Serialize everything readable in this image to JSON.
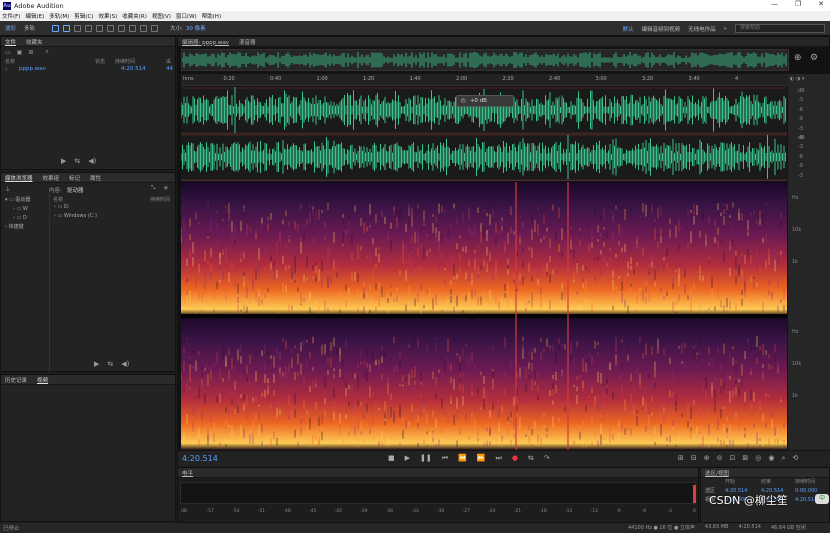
{
  "window": {
    "title": "Adobe Audition",
    "logo": "Au",
    "controls": [
      "—",
      "❐",
      "✕"
    ]
  },
  "menu": [
    "文件(F)",
    "编辑(E)",
    "多轨(M)",
    "剪辑(C)",
    "效果(S)",
    "收藏夹(R)",
    "视图(V)",
    "窗口(W)",
    "帮助(H)"
  ],
  "toolbar": {
    "waveform": "波形",
    "multitrack": "多轨",
    "size_label": "大小:",
    "size_value": "30 像素",
    "workspace_default": "默认",
    "workspace_edit": "编辑音频到视频",
    "workspace_radio": "无线电作品",
    "search_placeholder": "搜索帮助"
  },
  "files_panel": {
    "tabs": [
      "文件",
      "收藏夹"
    ],
    "headers": {
      "name": "名称",
      "status": "状态",
      "duration": "持续时间",
      "rate": "采"
    },
    "file": {
      "name": "pppp.wav",
      "duration": "4:20.514",
      "rate": "44"
    }
  },
  "media_panel": {
    "tabs": [
      "媒体浏览器",
      "效果组",
      "标记",
      "属性"
    ],
    "content_label": "内容:",
    "content_value": "驱动器",
    "headers": {
      "name": "名称",
      "duration": "持续时间"
    },
    "tree_left": [
      "驱动器",
      "W",
      "D",
      "快捷键"
    ],
    "tree_right": [
      "D:",
      "Windows (C:)"
    ]
  },
  "history_panel": {
    "tabs": [
      "历史记录",
      "视频"
    ]
  },
  "editor": {
    "tabs": [
      "编辑器: pppp.wav",
      "混音器"
    ],
    "ruler": [
      "hms",
      "0:20",
      "0:40",
      "1:00",
      "1:20",
      "1:40",
      "2:00",
      "2:20",
      "2:40",
      "3:00",
      "3:20",
      "3:40",
      "4"
    ],
    "db_top": [
      "dB",
      "-3",
      "-6",
      "-9",
      "-3",
      "-9"
    ],
    "db_bottom": [
      "dB",
      "-3",
      "-6",
      "-9",
      "-3"
    ],
    "hz_top": [
      "Hz",
      "10k",
      "1k"
    ],
    "hz_bottom": [
      "Hz",
      "10k",
      "1k"
    ],
    "hud": "+0 dB",
    "timecode": "4:20.514"
  },
  "levels": {
    "title": "电平",
    "scale": [
      "dB",
      "-57",
      "-54",
      "-51",
      "-48",
      "-45",
      "-42",
      "-39",
      "-36",
      "-33",
      "-30",
      "-27",
      "-24",
      "-21",
      "-18",
      "-15",
      "-12",
      "-9",
      "-6",
      "-3",
      "0"
    ]
  },
  "selection": {
    "title": "选区/视图",
    "headers": [
      "开始",
      "结束",
      "持续时间"
    ],
    "rows": [
      {
        "label": "选区",
        "start": "4:20.514",
        "end": "4:20.514",
        "dur": "0:00.000"
      },
      {
        "label": "视图",
        "start": "0:00.000",
        "end": "4:20.514",
        "dur": "4:20.514"
      }
    ]
  },
  "status": {
    "left": "已停止",
    "info": [
      "44100 Hz ● 16 位 ● 立体声",
      "43.83 MB",
      "4:20.514",
      "46.64 GB 空闲"
    ]
  },
  "watermark": "CSDN @柳尘笙",
  "colors": {
    "waveform": "#3fd59a",
    "accent": "#5aa0ff",
    "selection": "#d23b3b"
  }
}
